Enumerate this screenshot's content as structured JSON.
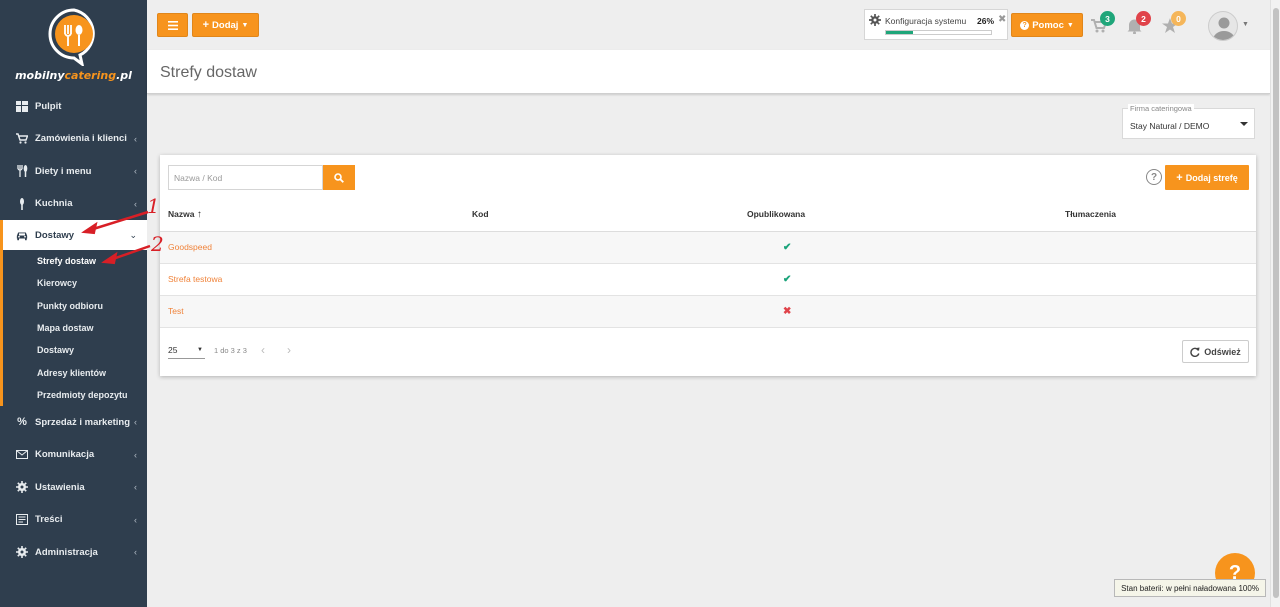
{
  "brand": {
    "name_part1": "mobilny",
    "name_part2": "catering",
    "name_part3": ".pl",
    "accent_color": "#f7941d",
    "sidebar_color": "#2f3e4e"
  },
  "sidebar": {
    "items": [
      {
        "label": "Pulpit",
        "icon": "dashboard-grid-icon"
      },
      {
        "label": "Zamówienia i klienci",
        "icon": "cart-icon"
      },
      {
        "label": "Diety i menu",
        "icon": "cutlery-icon"
      },
      {
        "label": "Kuchnia",
        "icon": "kitchen-icon"
      },
      {
        "label": "Dostawy",
        "icon": "car-icon"
      },
      {
        "label": "Sprzedaż i marketing",
        "icon": "percent-icon"
      },
      {
        "label": "Komunikacja",
        "icon": "envelope-icon"
      },
      {
        "label": "Ustawienia",
        "icon": "gear-icon"
      },
      {
        "label": "Treści",
        "icon": "content-icon"
      },
      {
        "label": "Administracja",
        "icon": "admin-gear-icon"
      }
    ],
    "subitems": [
      "Strefy dostaw",
      "Kierowcy",
      "Punkty odbioru",
      "Mapa dostaw",
      "Dostawy",
      "Adresy klientów",
      "Przedmioty depozytu"
    ]
  },
  "topbar": {
    "add_label": "Dodaj",
    "config_label": "Konfiguracja systemu",
    "config_percent": "26%",
    "config_progress": 0.26,
    "help_label": "Pomoc",
    "cart_count": "3",
    "notif_count": "2",
    "star_count": "0"
  },
  "page": {
    "title": "Strefy dostaw"
  },
  "company": {
    "label": "Firma cateringowa",
    "value": "Stay Natural / DEMO"
  },
  "table": {
    "search_placeholder": "Nazwa / Kod",
    "add_button": "Dodaj strefę",
    "columns": [
      "Nazwa",
      "Kod",
      "Opublikowana",
      "Tłumaczenia"
    ],
    "rows": [
      {
        "name": "Goodspeed",
        "code": "",
        "published": "✔",
        "translations": ""
      },
      {
        "name": "Strefa testowa",
        "code": "",
        "published": "✔",
        "translations": ""
      },
      {
        "name": "Test",
        "code": "",
        "published": "✖",
        "translations": ""
      }
    ],
    "page_size": "25",
    "pager_info": "1 do 3 z 3",
    "refresh_label": "Odśwież"
  },
  "annotations": {
    "first": "1",
    "second": "2"
  },
  "tooltip": "Stan baterii: w pełni naładowana 100%"
}
